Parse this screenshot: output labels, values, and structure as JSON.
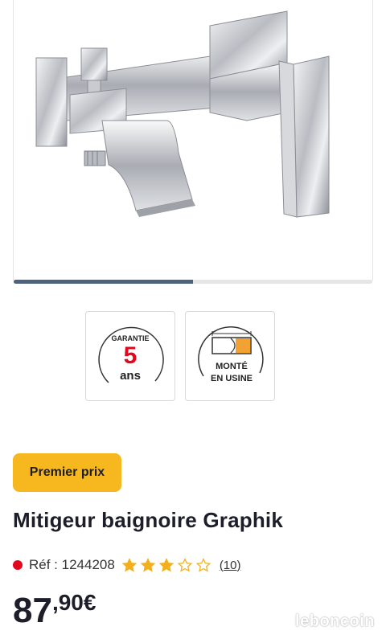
{
  "gallery": {
    "image_icon": "chrome-bath-mixer-tap",
    "slide_progress": 0.5,
    "colors": {
      "track": "#e6e6e6",
      "fill": "#50627a"
    }
  },
  "badges": [
    {
      "icon": "warranty-badge-icon",
      "top_text": "GARANTIE",
      "number": "5",
      "unit": "ans"
    },
    {
      "icon": "factory-assembled-icon",
      "line1": "MONTÉ",
      "line2": "EN USINE"
    }
  ],
  "tag": {
    "label": "Premier prix",
    "color": "#f7b81f"
  },
  "product": {
    "title": "Mitigeur baignoire Graphik",
    "reference": "Réf : 1244208",
    "status_color": "#e4061d",
    "rating": 3,
    "rating_max": 5,
    "review_count": "(10)",
    "star_color": "#f2b01e"
  },
  "price": {
    "integer": "87",
    "decimal": ",90€"
  },
  "watermark": "leboncoin"
}
